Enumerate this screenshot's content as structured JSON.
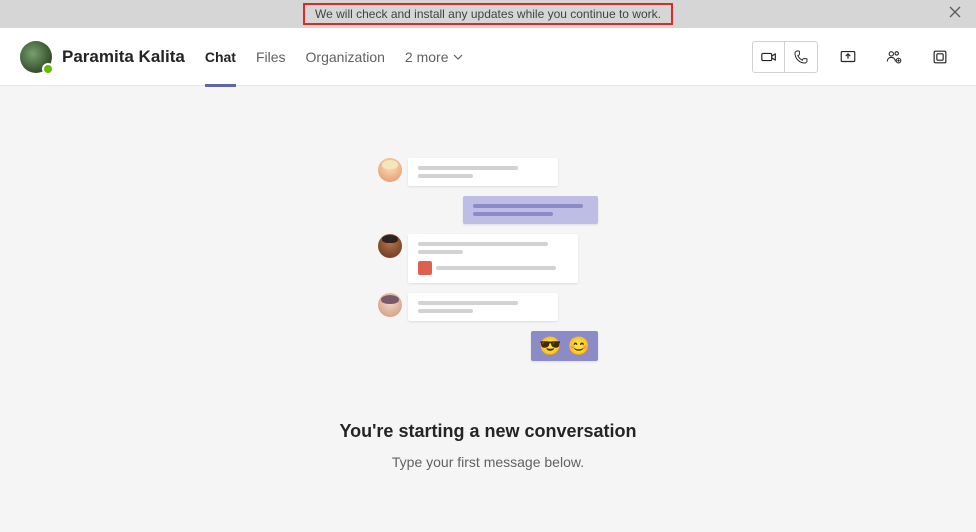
{
  "updateBar": {
    "message": "We will check and install any updates while you continue to work."
  },
  "header": {
    "contactName": "Paramita Kalita",
    "tabs": [
      {
        "label": "Chat",
        "active": true
      },
      {
        "label": "Files",
        "active": false
      },
      {
        "label": "Organization",
        "active": false
      }
    ],
    "moreLabel": "2 more"
  },
  "empty": {
    "headline": "You're starting a new conversation",
    "subline": "Type your first message below."
  }
}
